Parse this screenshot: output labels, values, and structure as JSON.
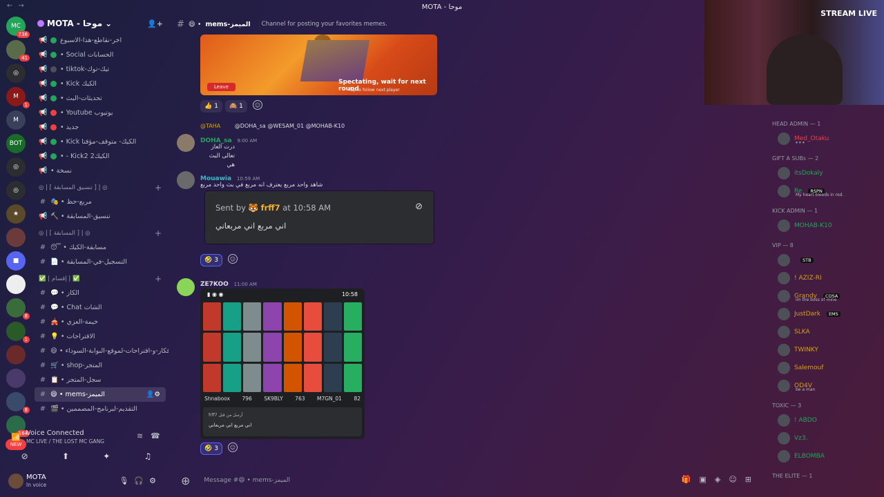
{
  "window": {
    "title": "MOTA - موحا"
  },
  "rail": {
    "servers": [
      {
        "label": "MC",
        "badge": "736",
        "color": "#23a55a"
      },
      {
        "label": "",
        "badge": "41",
        "color": "#5a6b4a"
      },
      {
        "label": "◎",
        "badge": "",
        "color": "#2b2d31"
      },
      {
        "label": "M",
        "badge": "1",
        "color": "#8a1a1a"
      },
      {
        "label": "M",
        "badge": "",
        "color": "#3a3f5c"
      },
      {
        "label": "BOT",
        "badge": "",
        "color": "#1a6b2a"
      },
      {
        "label": "◎",
        "badge": "",
        "color": "#2b2d31"
      },
      {
        "label": "◎",
        "badge": "",
        "color": "#2b2d31"
      },
      {
        "label": "★",
        "badge": "",
        "color": "#5a4a2a"
      },
      {
        "label": "",
        "badge": "",
        "color": "#6b3a3a"
      },
      {
        "label": "■",
        "badge": "",
        "color": "#5865f2"
      },
      {
        "label": "",
        "badge": "",
        "color": "#eeeeee"
      },
      {
        "label": "",
        "badge": "8",
        "color": "#3a6b3a"
      },
      {
        "label": "",
        "badge": "1",
        "color": "#2a5a2a"
      },
      {
        "label": "",
        "badge": "",
        "color": "#6b2a2a"
      },
      {
        "label": "",
        "badge": "",
        "color": "#4a3a6b"
      },
      {
        "label": "",
        "badge": "8",
        "color": "#3a4a6b"
      },
      {
        "label": "",
        "badge": "164",
        "color": "#2a6b4a"
      },
      {
        "label": "NEW",
        "badge": "",
        "color": "#f23f43"
      }
    ]
  },
  "sidebar": {
    "server_name": "MOTA - موحا",
    "channels": [
      {
        "pre": "📢",
        "dot": "green",
        "name": "اخر-نقاطع-هذا-الاسبوع"
      },
      {
        "pre": "📢",
        "dot": "green",
        "name": "• Social الحسابات"
      },
      {
        "pre": "📢",
        "dot": "grey",
        "name": "• tiktok-تيك-توك"
      },
      {
        "pre": "📢",
        "dot": "green",
        "name": "• Kick الكيك"
      },
      {
        "pre": "📢",
        "dot": "green",
        "name": "• تحديثات-البث"
      },
      {
        "pre": "📢",
        "dot": "red",
        "name": "• Youtube يوتيوب"
      },
      {
        "pre": "📢",
        "dot": "red",
        "name": "• جديد"
      },
      {
        "pre": "📢",
        "dot": "green",
        "name": "• Kick الكيك- متوقف-مؤقتا"
      },
      {
        "pre": "📢",
        "dot": "green",
        "name": "• - Kick2 الكيك2"
      },
      {
        "pre": "📢",
        "dot": "",
        "name": "• نسخة"
      }
    ],
    "cat1": "◎ | [ تنسيق المسابقة ] | ◎",
    "channels2": [
      {
        "pre": "#",
        "name": "🎭 • مربع-حظ"
      },
      {
        "pre": "📢",
        "name": "🔨 • تنسيق-المسابقة"
      }
    ],
    "cat2": "◎ | [ المسابقة ] | ◎",
    "channels3": [
      {
        "pre": "#",
        "name": "😴 • مسابقة-الكيك"
      },
      {
        "pre": "#",
        "name": "📄 • التسجيل-في-المسابقة"
      }
    ],
    "cat3": "✅ | إقسام | ✅",
    "channels4": [
      {
        "pre": "#",
        "name": "💬 • الكاز"
      },
      {
        "pre": "#",
        "name": "💬 • Chat الشات"
      },
      {
        "pre": "#",
        "name": "🎪 • خيمة-العزي"
      },
      {
        "pre": "#",
        "name": "💡 • الاقتراحات"
      },
      {
        "pre": "#",
        "name": "😄 • افكار-و-اقتراحات-لموقع-البوابة-السوداء"
      },
      {
        "pre": "#",
        "name": "🛒 • shop-المتجر"
      },
      {
        "pre": "#",
        "name": "📋 • سجل-المتجر"
      },
      {
        "pre": "#",
        "name": "😄 • mems-الميمز",
        "active": true
      },
      {
        "pre": "#",
        "name": "🎬 • التقديم-لبرنامج-المصممين"
      }
    ]
  },
  "voice": {
    "title": "Voice Connected",
    "sub": "MC LIVE / THE LOST MC GANG"
  },
  "user": {
    "name": "MOTA",
    "status": "In voice"
  },
  "chat": {
    "channel_name": "mems-الميمز",
    "topic": "Channel for posting your favorites memes.",
    "game_embed": {
      "leave": "Leave",
      "spectating": "Spectating, wait for next round",
      "tap": "Tap to follow next player"
    },
    "reactions1": [
      {
        "emoji": "👍",
        "count": "1"
      },
      {
        "emoji": "🙈",
        "count": "1"
      }
    ],
    "msg1": {
      "reply_author": "@TAHA",
      "reply_text": "@DOHA_sa @WESAM_01 @MOHAB-K10",
      "author": "DOHA_sa",
      "time": "9:00 AM",
      "line1": "درت العاز",
      "line2": "تعالى البث هي"
    },
    "msg2": {
      "author": "Mouawia",
      "time": "10:59 AM",
      "text": "شاهد واحد مربع يعترف انه مربع في بث واحد مربع"
    },
    "quote": {
      "sent_by": "Sent by",
      "sender": "frff7",
      "at": "at 10:58 AM",
      "text": "اني مربع اني مربعاني"
    },
    "reactions2": [
      {
        "emoji": "🤣",
        "count": "3"
      }
    ],
    "msg3": {
      "author": "ZE7KOO",
      "time": "11:00 AM"
    },
    "shot": {
      "time": "10:58",
      "stats": [
        "Shnaboox",
        "796",
        "SK9BLY",
        "763",
        "M7GN_01",
        "82"
      ],
      "mini1": "frff7 أرسل من قبل",
      "mini2": "اني مربع اني مربعاني"
    },
    "reactions3": [
      {
        "emoji": "🤣",
        "count": "3"
      }
    ],
    "composer_placeholder": "Message #😄 • mems-الميمز"
  },
  "webcam": {
    "sign": "STREAM LIVE"
  },
  "members": {
    "groups": [
      {
        "title": "HEAD ADMIN — 1",
        "items": [
          {
            "name": "Med_Otaku",
            "color": "#f23f43",
            "sub": "⏸ ⏸ ⏸"
          }
        ]
      },
      {
        "title": "GIFT A SUBs — 2",
        "items": [
          {
            "name": "itsDokaly",
            "color": "#23a55a",
            "sub": ""
          },
          {
            "name": "Re",
            "color": "#23a55a",
            "sub": "My heart bleeds in red.",
            "tag": "RSPN"
          }
        ]
      },
      {
        "title": "KICK ADMIN — 1",
        "items": [
          {
            "name": "MOHAB-K10",
            "color": "#23a55a",
            "sub": ""
          }
        ]
      },
      {
        "title": "VIP — 8",
        "items": [
          {
            "name": "",
            "color": "#dbdee1",
            "sub": "",
            "tag": "STB"
          },
          {
            "name": "! AZIZ-RI",
            "color": "#d4a017",
            "sub": ""
          },
          {
            "name": "Grandy",
            "color": "#d4a017",
            "sub": "im the boss of mine",
            "tag": "COSA"
          },
          {
            "name": "JustDark",
            "color": "#d4a017",
            "sub": "",
            "tag": "EMS"
          },
          {
            "name": "SLKA",
            "color": "#d4a017",
            "sub": ""
          },
          {
            "name": "TWINKY",
            "color": "#d4a017",
            "sub": ""
          },
          {
            "name": "Salemouf",
            "color": "#d4a017",
            "sub": ""
          },
          {
            "name": "OD4V",
            "color": "#d4a017",
            "sub": "be a man"
          }
        ]
      },
      {
        "title": "TOXIC — 3",
        "items": [
          {
            "name": "! ABDO",
            "color": "#23a55a",
            "sub": ""
          },
          {
            "name": "Vz3.",
            "color": "#23a55a",
            "sub": ""
          },
          {
            "name": "ELBOMBA",
            "color": "#23a55a",
            "sub": ""
          }
        ]
      },
      {
        "title": "THE ELITE — 1",
        "items": []
      }
    ]
  }
}
